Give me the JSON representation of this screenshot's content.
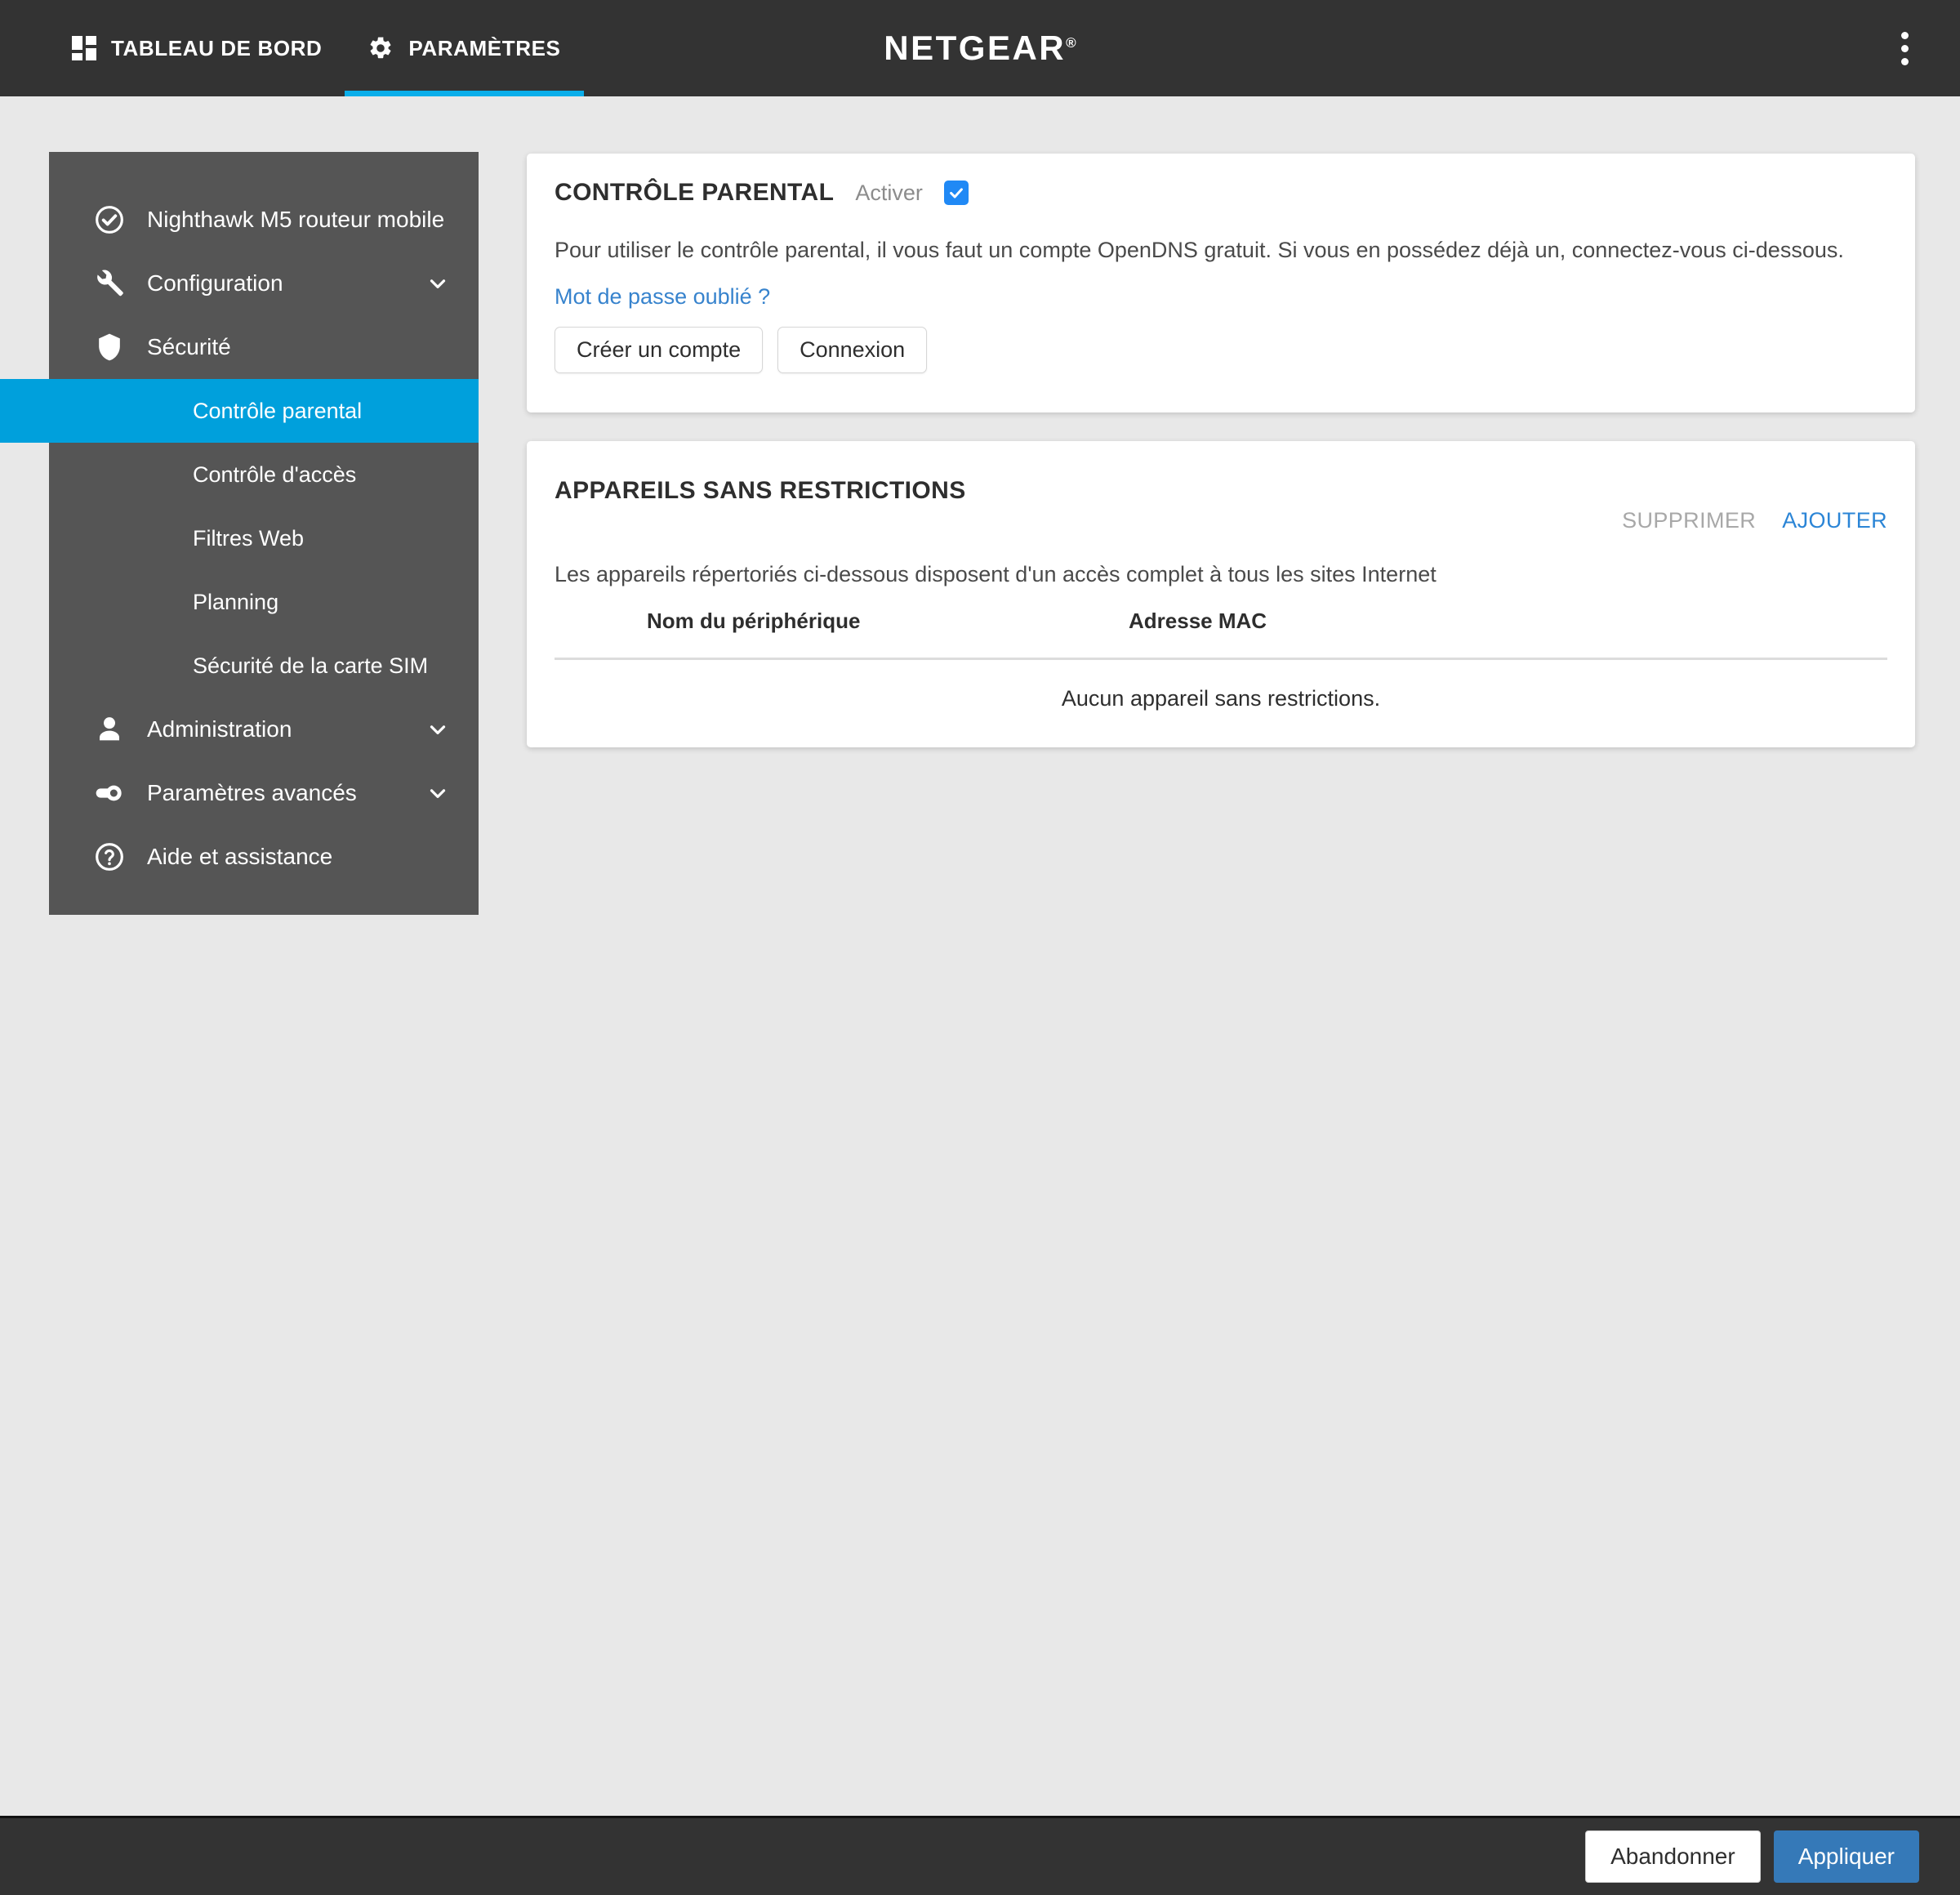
{
  "header": {
    "tabs": [
      {
        "label": "TABLEAU DE BORD",
        "icon": "dashboard-grid-icon",
        "active": false
      },
      {
        "label": "PARAMÈTRES",
        "icon": "gear-icon",
        "active": true
      }
    ],
    "brand": "NETGEAR",
    "brand_registered": "®",
    "overflow_icon": "kebab-menu-icon"
  },
  "sidebar": {
    "items": [
      {
        "label": "Nighthawk M5 routeur mobile",
        "icon": "check-circle-icon",
        "expandable": false
      },
      {
        "label": "Configuration",
        "icon": "wrench-icon",
        "expandable": true
      },
      {
        "label": "Sécurité",
        "icon": "shield-icon",
        "expandable": false
      }
    ],
    "sub_items": [
      {
        "label": "Contrôle parental",
        "active": true
      },
      {
        "label": "Contrôle d'accès",
        "active": false
      },
      {
        "label": "Filtres Web",
        "active": false
      },
      {
        "label": "Planning",
        "active": false
      },
      {
        "label": "Sécurité de la carte SIM",
        "active": false
      }
    ],
    "items_bottom": [
      {
        "label": "Administration",
        "icon": "person-icon",
        "expandable": true
      },
      {
        "label": "Paramètres avancés",
        "icon": "toggle-switch-icon",
        "expandable": true
      },
      {
        "label": "Aide et assistance",
        "icon": "help-circle-icon",
        "expandable": false
      }
    ]
  },
  "parental_control": {
    "title": "CONTRÔLE PARENTAL",
    "enable_label": "Activer",
    "enabled": true,
    "description": "Pour utiliser le contrôle parental, il vous faut un compte OpenDNS gratuit. Si vous en possédez déjà un, connectez-vous ci-dessous.",
    "forgot_password_link": "Mot de passe oublié ?",
    "create_account_button": "Créer un compte",
    "login_button": "Connexion"
  },
  "devices": {
    "title": "APPAREILS SANS RESTRICTIONS",
    "delete_action": "SUPPRIMER",
    "add_action": "AJOUTER",
    "description": "Les appareils répertoriés ci-dessous disposent d'un accès complet à tous les sites Internet",
    "columns": {
      "name": "Nom du périphérique",
      "mac": "Adresse MAC"
    },
    "rows": [],
    "empty_message": "Aucun appareil sans restrictions."
  },
  "footer": {
    "cancel_button": "Abandonner",
    "apply_button": "Appliquer"
  },
  "colors": {
    "topbar": "#333333",
    "sidebar": "#555555",
    "active_accent": "#00a0dc",
    "tab_underline": "#0aaeea",
    "checkbox": "#2089f5",
    "link": "#3783cd",
    "apply_button": "#3579b8",
    "page_background": "#e8e8e8"
  }
}
